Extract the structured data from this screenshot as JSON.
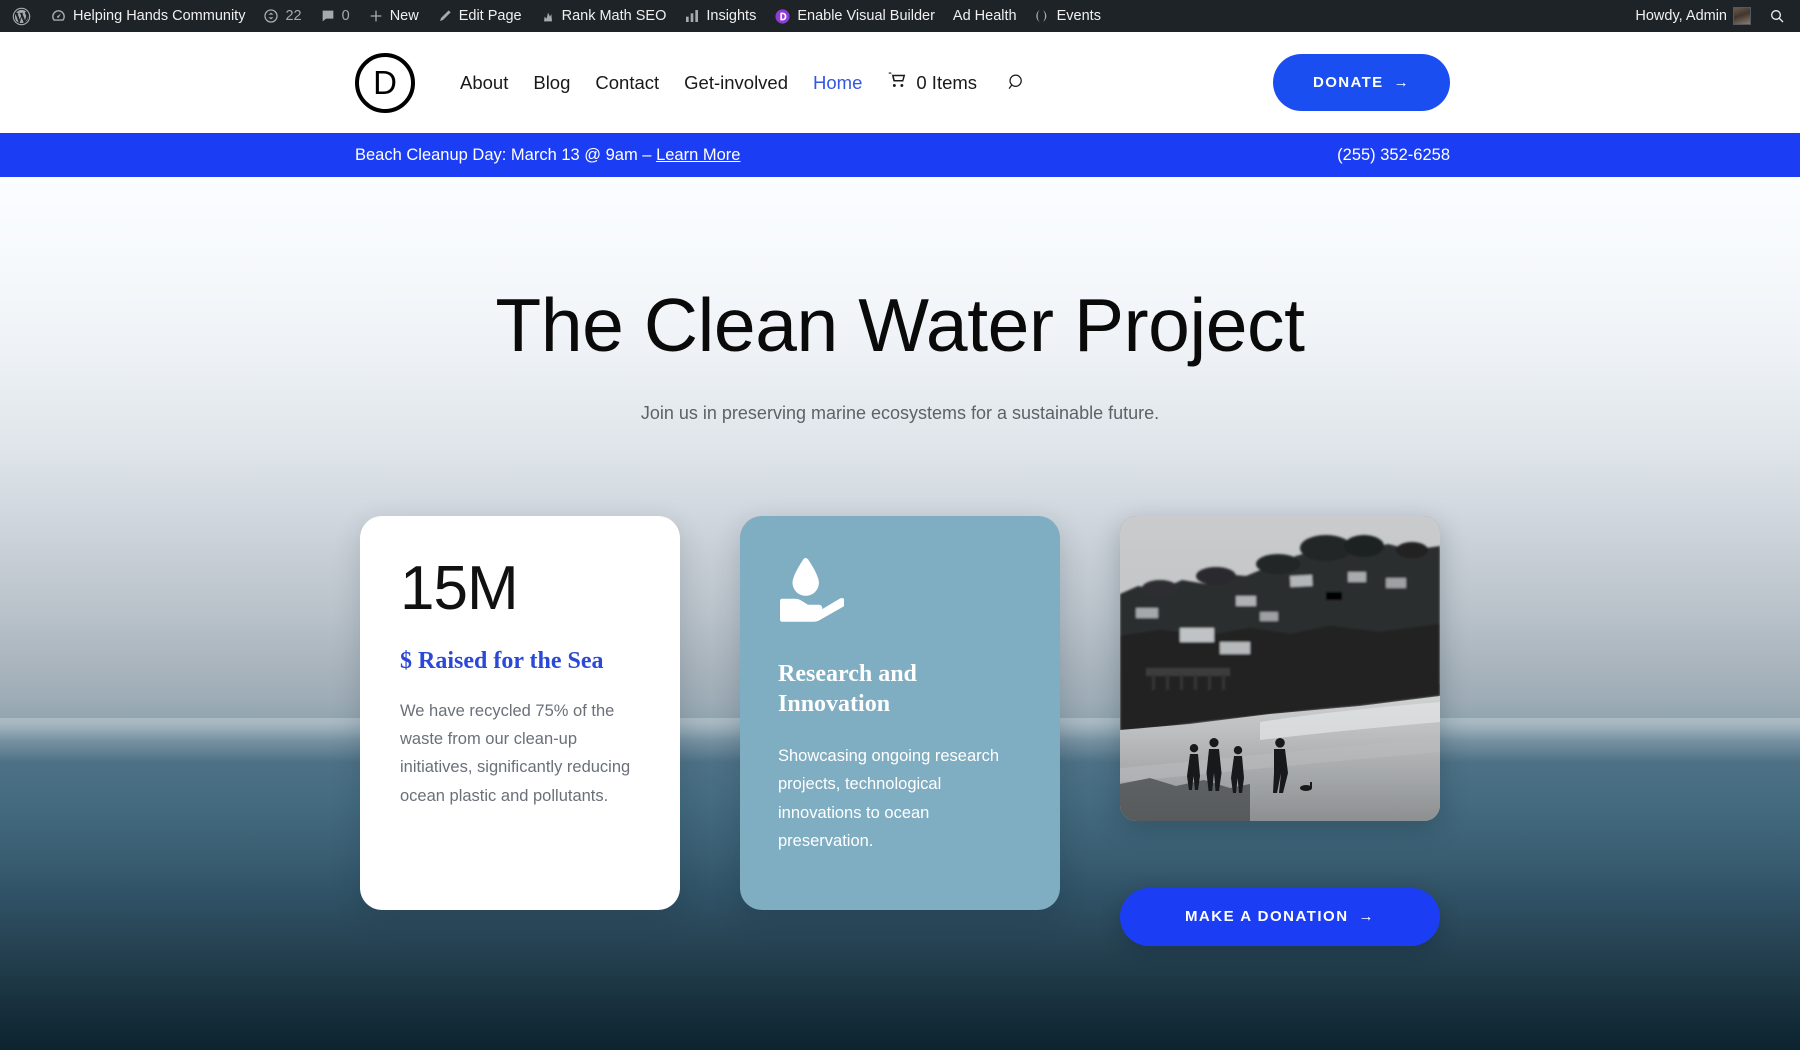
{
  "adminbar": {
    "wp_logo": "wordpress-logo-icon",
    "left_items": [
      {
        "name": "site-name",
        "icon": "dashboard-icon",
        "label": "Helping Hands Community"
      },
      {
        "name": "updates",
        "icon": "updates-icon",
        "label": "22"
      },
      {
        "name": "comments",
        "icon": "comment-bubble-icon",
        "label": "0"
      },
      {
        "name": "new-content",
        "icon": "plus-icon",
        "label": "New"
      },
      {
        "name": "edit-page",
        "icon": "pencil-icon",
        "label": "Edit Page"
      },
      {
        "name": "rank-math-seo",
        "icon": "rank-math-icon",
        "label": "Rank Math SEO"
      },
      {
        "name": "insights",
        "icon": "bar-chart-icon",
        "label": "Insights"
      },
      {
        "name": "enable-visual-builder",
        "icon": "divi-icon",
        "label": "Enable Visual Builder"
      },
      {
        "name": "ad-health",
        "icon": "",
        "label": "Ad Health"
      },
      {
        "name": "events",
        "icon": "events-icon",
        "label": "Events"
      }
    ],
    "howdy": "Howdy, Admin",
    "avatar": "user-avatar",
    "search": "search-icon"
  },
  "header": {
    "logo_letter": "D",
    "nav": [
      {
        "label": "About",
        "active": false
      },
      {
        "label": "Blog",
        "active": false
      },
      {
        "label": "Contact",
        "active": false
      },
      {
        "label": "Get-involved",
        "active": false
      },
      {
        "label": "Home",
        "active": true
      }
    ],
    "cart": {
      "icon": "shopping-cart-icon",
      "label": "0 Items"
    },
    "search_icon": "search-icon",
    "donate_label": "DONATE",
    "donate_arrow": "→"
  },
  "announcement": {
    "message_prefix": "Beach Cleanup Day: March 13 @ 9am – ",
    "link_label": "Learn More",
    "phone": "(255) 352-6258"
  },
  "hero": {
    "title": "The Clean Water Project",
    "subtitle": "Join us in preserving marine ecosystems for a sustainable future."
  },
  "cards": {
    "stat": {
      "number": "15M",
      "label": "$ Raised for the Sea",
      "text": "We have recycled 75% of the waste from our clean-up initiatives, significantly reducing ocean plastic and pollutants."
    },
    "research": {
      "icon": "water-drop-in-hand-icon",
      "title": "Research and Innovation",
      "text": "Showcasing ongoing research projects, technological innovations to ocean preservation."
    },
    "media": {
      "photo_alt": "black-and-white-beach-coastline-photo",
      "button_label": "MAKE A DONATION",
      "button_arrow": "→"
    }
  },
  "colors": {
    "brand_blue": "#1b3ef5",
    "nav_active": "#3257e3",
    "card_blue": "#7fadc2",
    "stat_label_blue": "#2b48d6",
    "adminbar_bg": "#1d2327"
  }
}
